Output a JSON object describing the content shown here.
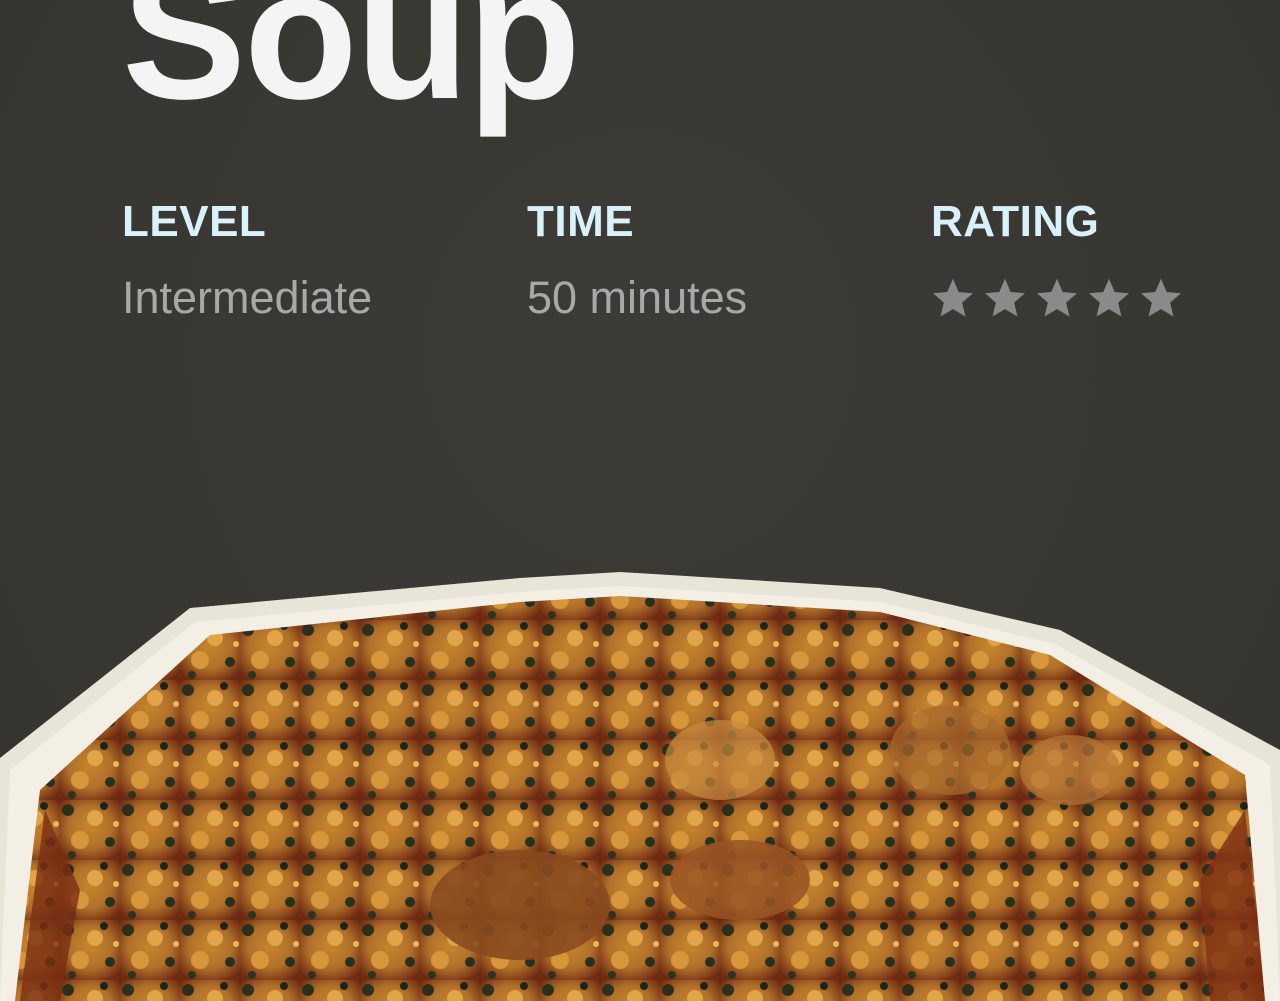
{
  "recipe": {
    "title": "Soup",
    "level_label": "LEVEL",
    "level_value": "Intermediate",
    "time_label": "TIME",
    "time_value": "50 minutes",
    "rating_label": "RATING",
    "rating_stars": 5,
    "rating_filled": 0
  },
  "icons": {
    "star": "star-icon"
  },
  "colors": {
    "background": "#3a3833",
    "title": "#f4f4f4",
    "label": "#d8f1fb",
    "value": "#a9a8a6",
    "star": "#8a8a8a"
  }
}
